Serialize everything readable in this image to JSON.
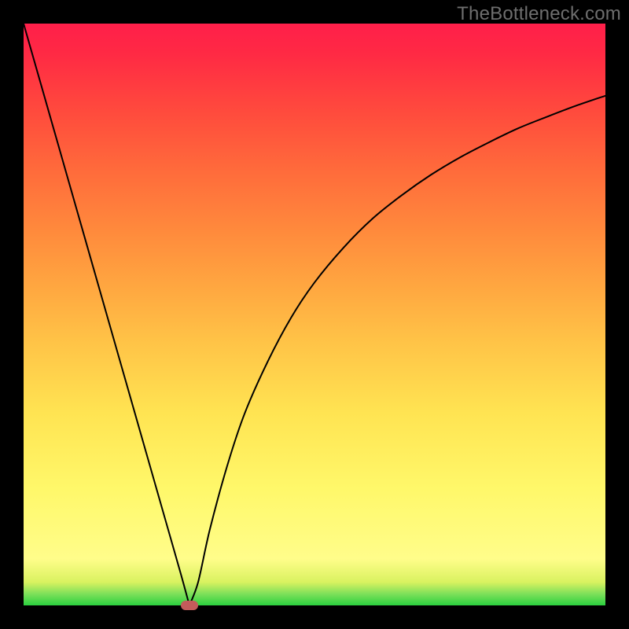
{
  "watermark": "TheBottleneck.com",
  "chart_data": {
    "type": "line",
    "title": "",
    "xlabel": "",
    "ylabel": "",
    "xlim": [
      0,
      100
    ],
    "ylim": [
      0,
      100
    ],
    "grid": false,
    "series": [
      {
        "name": "curve",
        "x": [
          0,
          3,
          6,
          9,
          12,
          15,
          18,
          21,
          24,
          27,
          28.5,
          30,
          32,
          35,
          38,
          42,
          46,
          50,
          55,
          60,
          65,
          70,
          75,
          80,
          85,
          90,
          95,
          100
        ],
        "values": [
          100,
          89.5,
          79,
          68.5,
          58,
          47.5,
          37,
          26.5,
          16,
          5.5,
          0,
          4,
          13,
          24,
          33,
          42,
          49.5,
          55.5,
          61.5,
          66.5,
          70.5,
          74,
          77,
          79.6,
          82,
          84,
          85.9,
          87.6
        ]
      }
    ],
    "minimum_marker": {
      "x": 28.5,
      "y": 0,
      "color": "#c45b5b"
    }
  }
}
